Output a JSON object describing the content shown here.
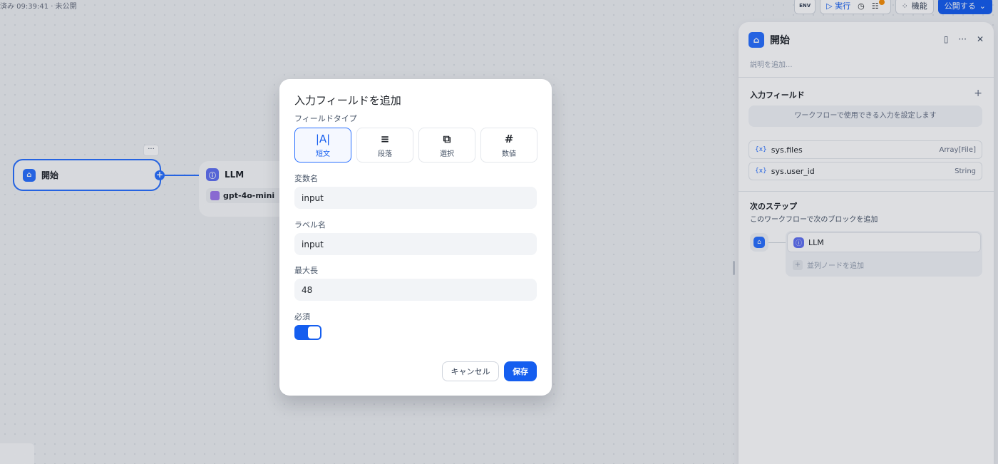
{
  "topbar": {
    "status": "済み 09:39:41 · 未公開",
    "env_label": "ENV",
    "run_label": "実行",
    "features_label": "機能",
    "publish_label": "公開する"
  },
  "canvas": {
    "start_node": {
      "title": "開始"
    },
    "llm_node": {
      "title": "LLM",
      "model": "gpt-4o-mini"
    },
    "more_label": "···",
    "plus_label": "+"
  },
  "panel": {
    "title": "開始",
    "description_placeholder": "説明を追加...",
    "input_fields_title": "入力フィールド",
    "input_fields_hint": "ワークフローで使用できる入力を設定します",
    "variables": [
      {
        "icon": "{x}",
        "name": "sys.files",
        "type": "Array[File]"
      },
      {
        "icon": "{x}",
        "name": "sys.user_id",
        "type": "String"
      }
    ],
    "next_step_title": "次のステップ",
    "next_step_subtitle": "このワークフローで次のブロックを追加",
    "next_node_label": "LLM",
    "add_parallel_label": "並列ノードを追加"
  },
  "modal": {
    "title": "入力フィールドを追加",
    "field_type_label": "フィールドタイプ",
    "types": [
      {
        "label": "短文",
        "icon": "|A|",
        "active": true
      },
      {
        "label": "段落",
        "icon": "≡",
        "active": false
      },
      {
        "label": "選択",
        "icon": "⧉",
        "active": false
      },
      {
        "label": "数値",
        "icon": "#",
        "active": false
      }
    ],
    "variable_name_label": "変数名",
    "variable_name_value": "input",
    "label_name_label": "ラベル名",
    "label_name_value": "input",
    "max_length_label": "最大長",
    "max_length_value": "48",
    "required_label": "必須",
    "required": true,
    "cancel_label": "キャンセル",
    "save_label": "保存"
  },
  "colors": {
    "accent": "#155eef",
    "node_border": "#2970ff",
    "llm_icon": "#6172f3"
  }
}
